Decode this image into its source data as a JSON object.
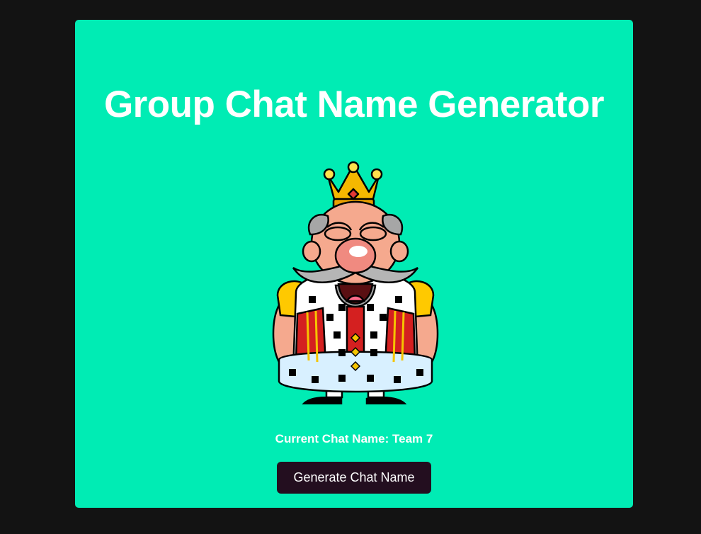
{
  "page": {
    "title": "Group Chat Name Generator",
    "mascot_icon": "king-mascot-icon",
    "current_label": "Current Chat Name:",
    "current_value": "Team 7",
    "button_label": "Generate Chat Name"
  },
  "colors": {
    "background": "#131313",
    "card": "#00ecb4",
    "button": "#230e1f",
    "text": "#ffffff"
  }
}
